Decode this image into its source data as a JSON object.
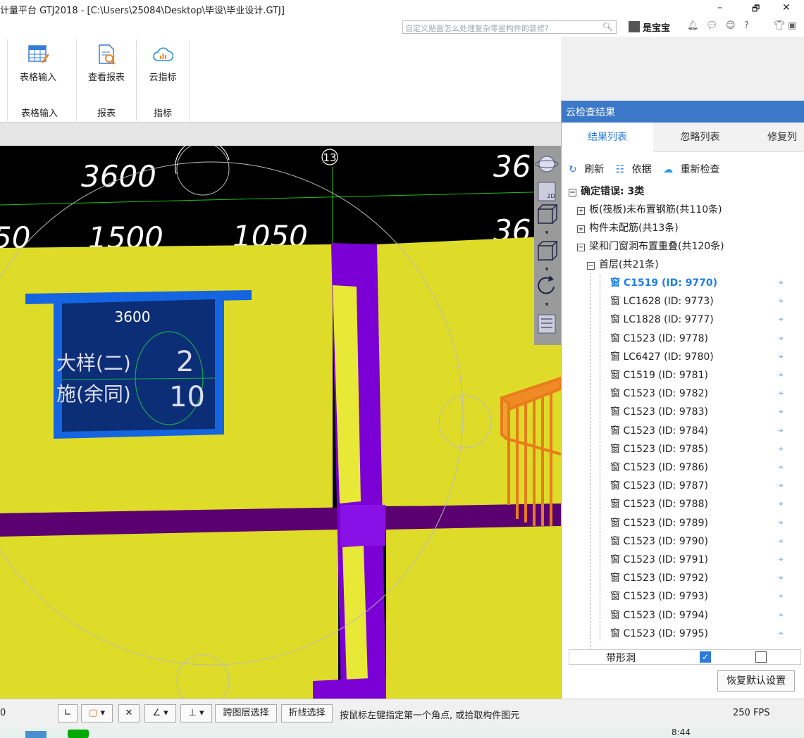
{
  "window": {
    "title": "计量平台 GTJ2018 - [C:\\Users\\25084\\Desktop\\毕设\\毕业设计.GTJ]",
    "search_placeholder": "自定义贴面怎么处理复杂零星构件的装修?",
    "username": "是宝宝",
    "min": "–",
    "restore": "🗗",
    "close": "✕"
  },
  "ribbon": {
    "buttons": [
      {
        "label": "表格输入",
        "icon": "table-input-icon"
      },
      {
        "label": "查看报表",
        "icon": "report-icon"
      },
      {
        "label": "云指标",
        "icon": "cloud-index-icon"
      }
    ],
    "groups": [
      "表格输入",
      "报表",
      "指标"
    ]
  },
  "drawing": {
    "dims_top": [
      "3600",
      "36"
    ],
    "dims_mid": [
      "50",
      "1500",
      "1050",
      "36"
    ],
    "axis_label": "13",
    "window_label": "3600",
    "text_a": "大样(二)",
    "text_b": "施(余同)",
    "num_a": "2",
    "num_b": "10"
  },
  "panel": {
    "title": "云检查结果",
    "tabs": [
      "结果列表",
      "忽略列表",
      "修复列"
    ],
    "actions": [
      "刷新",
      "依据",
      "重新检查"
    ],
    "root_label": "确定错误:",
    "root_count": "3类",
    "categories": [
      "板(筏板)未布置钢筋(共110条)",
      "构件未配筋(共13条)",
      "梁和门窗洞布置重叠(共120条)"
    ],
    "floor": "首层(共21条)",
    "items": [
      "窗 C1519 (ID: 9770)",
      "窗 LC1628 (ID: 9773)",
      "窗 LC1828 (ID: 9777)",
      "窗 C1523 (ID: 9778)",
      "窗 LC6427 (ID: 9780)",
      "窗 C1519 (ID: 9781)",
      "窗 C1523 (ID: 9782)",
      "窗 C1523 (ID: 9783)",
      "窗 C1523 (ID: 9784)",
      "窗 C1523 (ID: 9785)",
      "窗 C1523 (ID: 9786)",
      "窗 C1523 (ID: 9787)",
      "窗 C1523 (ID: 9788)",
      "窗 C1523 (ID: 9789)",
      "窗 C1523 (ID: 9790)",
      "窗 C1523 (ID: 9791)",
      "窗 C1523 (ID: 9792)",
      "窗 C1523 (ID: 9793)",
      "窗 C1523 (ID: 9794)",
      "窗 C1523 (ID: 9795)"
    ],
    "prop_label": "带形洞",
    "reset_label": "恢复默认设置"
  },
  "status": {
    "left_value": "0",
    "cross_layer": "跨图层选择",
    "polyline": "折线选择",
    "hint": "按鼠标左键指定第一个角点, 或拾取构件图元",
    "fps": "250 FPS"
  },
  "taskbar": {
    "time": "8:44"
  },
  "colors": {
    "wall": "#dedc28",
    "beam": "#7a00d6",
    "window_frame": "#1565e0",
    "window_glass": "#0c2e76",
    "panel_header": "#3c78c8",
    "accent": "#1e7ee0"
  }
}
